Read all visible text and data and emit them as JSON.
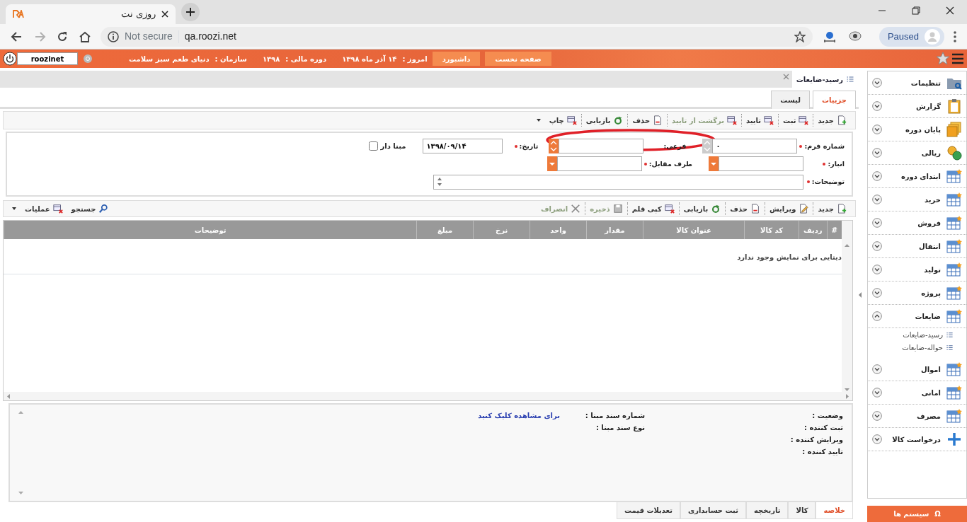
{
  "browser": {
    "tab_title": "روزی نت",
    "security": "Not secure",
    "url": "qa.roozi.net",
    "profile": "Paused",
    "forward_disabled": true
  },
  "header": {
    "user_field": "roozinet",
    "buttons": [
      {
        "label": "صفحه نخست"
      },
      {
        "label": "داشبورد"
      }
    ],
    "info": [
      {
        "label": "امروز :",
        "value": "۱۴ آذر ماه ۱۳۹۸"
      },
      {
        "label": "دوره مالی :",
        "value": "۱۳۹۸"
      },
      {
        "label": "سازمان :",
        "value": "دنیای طعم سبز سلامت"
      }
    ]
  },
  "document_tab": {
    "title": "رسید-ضایعات"
  },
  "tabs": [
    {
      "label": "جزییات",
      "selected": true
    },
    {
      "label": "لیست",
      "selected": false
    }
  ],
  "toolbar": [
    {
      "label": "جدید",
      "disabled": false,
      "dropdown": false
    },
    {
      "label": "ثبت",
      "disabled": false,
      "dropdown": false
    },
    {
      "label": "تایید",
      "disabled": false,
      "dropdown": false
    },
    {
      "label": "برگشت از تایید",
      "disabled": true,
      "dropdown": false
    },
    {
      "label": "حذف",
      "disabled": false,
      "dropdown": false
    },
    {
      "label": "بازیابی",
      "disabled": false,
      "dropdown": false
    },
    {
      "label": "چاپ",
      "disabled": false,
      "dropdown": true
    }
  ],
  "form": {
    "rows": [
      [
        {
          "kind": "spinner",
          "label": "شماره فرم:",
          "required": true,
          "value": "۰",
          "disabled": true
        },
        {
          "kind": "spinner",
          "label": "فرعی:",
          "required": false,
          "disabled": false
        },
        {
          "kind": "text",
          "label": "تاریخ:",
          "required": true,
          "value": "۱۳۹۸/۰۹/۱۴"
        },
        {
          "kind": "checkbox",
          "label": "مبنا دار",
          "checked": false
        }
      ],
      [
        {
          "kind": "combo",
          "label": "انبار:",
          "required": true
        },
        {
          "kind": "combo",
          "label": "طرف مقابل:",
          "required": true
        }
      ],
      [
        {
          "kind": "textarea",
          "label": "توضیحات:",
          "required": true
        }
      ]
    ]
  },
  "annotations": [
    {
      "kind": "ellipse"
    }
  ],
  "grid_toolbar": {
    "items": [
      {
        "label": "جدید",
        "disabled": false
      },
      {
        "label": "ویرایش",
        "disabled": false
      },
      {
        "label": "حذف",
        "disabled": false
      },
      {
        "label": "بازیابی",
        "disabled": false
      },
      {
        "label": "کپی قلم",
        "disabled": false
      },
      {
        "label": "ذخیره",
        "disabled": true
      },
      {
        "label": "انصراف",
        "disabled": true
      }
    ],
    "extra": [
      {
        "label": "جستجو",
        "dropdown": false
      },
      {
        "label": "عملیات",
        "dropdown": true
      }
    ]
  },
  "grid": {
    "columns": [
      "#",
      "ردیف",
      "کد کالا",
      "عنوان کالا",
      "مقدار",
      "واحد",
      "نرخ",
      "مبلغ",
      "توضیحات"
    ],
    "empty_message": "دیتایی برای نمایش وجود ندارد"
  },
  "summary": {
    "fields": [
      {
        "label": "وضعیت :"
      },
      {
        "label": "ثبت کننده :"
      },
      {
        "label": "ویرایش کننده :"
      },
      {
        "label": "تایید کننده :"
      }
    ],
    "source_fields": [
      {
        "label": "شماره سند مبنا :"
      },
      {
        "label": "نوع سند مبنا :"
      }
    ],
    "link": "برای مشاهده کلیک کنید"
  },
  "bottom_tabs": [
    {
      "label": "خلاصه",
      "selected": true
    },
    {
      "label": "کالا",
      "selected": false
    },
    {
      "label": "تاریخچه",
      "selected": false
    },
    {
      "label": "ثبت حسابداری",
      "selected": false
    },
    {
      "label": "تعدیلات قیمت",
      "selected": false
    }
  ],
  "sidebar": {
    "items": [
      {
        "label": "تنظیمات",
        "expanded": false
      },
      {
        "label": "گزارش",
        "expanded": false
      },
      {
        "label": "پایان دوره",
        "expanded": false
      },
      {
        "label": "ریالی",
        "expanded": false
      },
      {
        "label": "ابتدای دوره",
        "expanded": false
      },
      {
        "label": "خرید",
        "expanded": false
      },
      {
        "label": "فروش",
        "expanded": false
      },
      {
        "label": "انتقال",
        "expanded": false
      },
      {
        "label": "تولید",
        "expanded": false
      },
      {
        "label": "پروژه",
        "expanded": false
      },
      {
        "label": "ضایعات",
        "expanded": true,
        "children": [
          {
            "label": "رسید-ضایعات"
          },
          {
            "label": "حواله-ضایعات"
          }
        ]
      },
      {
        "label": "اموال",
        "expanded": false
      },
      {
        "label": "امانی",
        "expanded": false
      },
      {
        "label": "مصرف",
        "expanded": false
      },
      {
        "label": "درخواست کالا",
        "expanded": false
      }
    ],
    "footer_button": {
      "symbol": "Ω",
      "label": "سیستم ها"
    }
  }
}
